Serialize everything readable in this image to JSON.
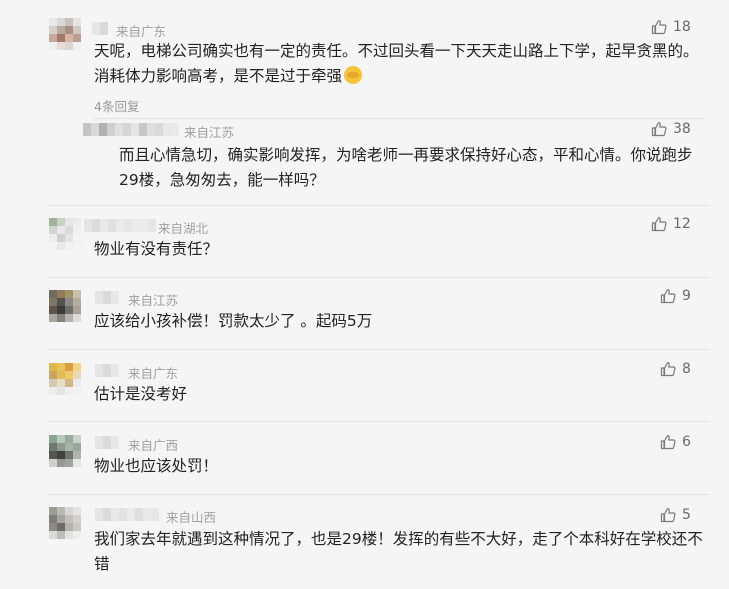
{
  "comments": [
    {
      "location": "来自广东",
      "likes": "18",
      "text": "天呢，电梯公司确实也有一定的责任。不过回头看一下天天走山路上下学，起早贪黑的。消耗体力影响高考，是不是过于牵强",
      "emoji": "facepalm",
      "replies_toggle": "4条回复",
      "reply": {
        "location": "来自江苏",
        "likes": "38",
        "text": "而且心情急切，确实影响发挥，为啥老师一再要求保持好心态，平和心情。你说跑步29楼，急匆匆去，能一样吗？"
      }
    },
    {
      "location": "来自湖北",
      "likes": "12",
      "text": "物业有没有责任？"
    },
    {
      "location": "来自江苏",
      "likes": "9",
      "text": "应该给小孩补偿！罚款太少了 。起码5万"
    },
    {
      "location": "来自广东",
      "likes": "8",
      "text": "估计是没考好"
    },
    {
      "location": "来自广西",
      "likes": "6",
      "text": "物业也应该处罚！"
    },
    {
      "location": "来自山西",
      "likes": "5",
      "text": "我们家去年就遇到这种情况了，也是29楼！发挥的有些不大好，走了个本科好在学校还不错"
    }
  ],
  "icons": {
    "like": "thumbs-up-icon",
    "emoji": "facepalm-emoji-icon"
  },
  "colors": {
    "text": "#222222",
    "meta": "#a0a0a0",
    "like": "#6a6a6a",
    "background": "#f5f5f5"
  }
}
